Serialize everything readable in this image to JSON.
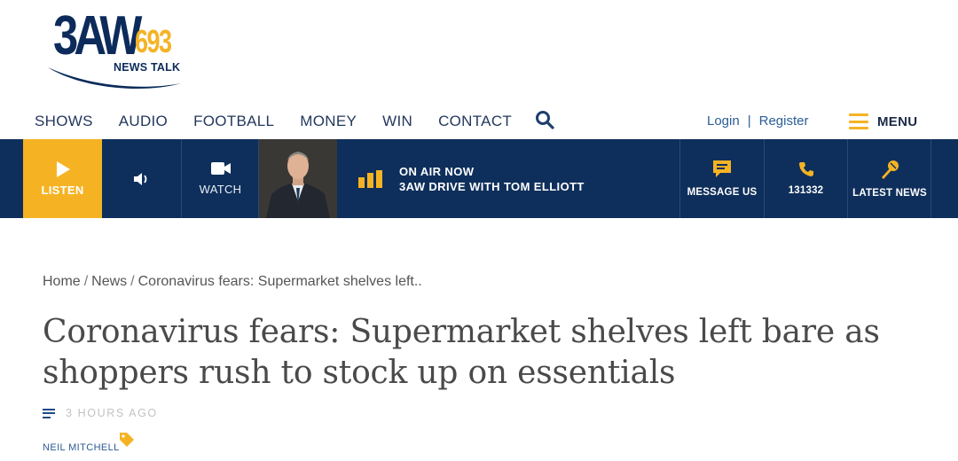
{
  "logo": {
    "main": "3AW",
    "number": "693",
    "sub": "NEWS TALK"
  },
  "nav": {
    "items": [
      "SHOWS",
      "AUDIO",
      "FOOTBALL",
      "MONEY",
      "WIN",
      "CONTACT"
    ],
    "login": "Login",
    "separator": "|",
    "register": "Register",
    "menu": "MENU"
  },
  "bar": {
    "listen": "LISTEN",
    "watch": "WATCH",
    "on_air_label": "ON AIR NOW",
    "on_air_show": "3AW DRIVE WITH TOM ELLIOTT",
    "message": "MESSAGE US",
    "phone": "131332",
    "latest": "LATEST NEWS"
  },
  "breadcrumb": {
    "home": "Home",
    "news": "News",
    "current": "Coronavirus fears: Supermarket shelves left..",
    "sep": "/"
  },
  "article": {
    "headline": "Coronavirus fears: Supermarket shelves left bare as shoppers rush to stock up on essentials",
    "time": "3 HOURS AGO",
    "author": "NEIL MITCHELL"
  },
  "colors": {
    "navy": "#0e2f5b",
    "accent": "#f5b324",
    "link": "#2b5d97"
  }
}
